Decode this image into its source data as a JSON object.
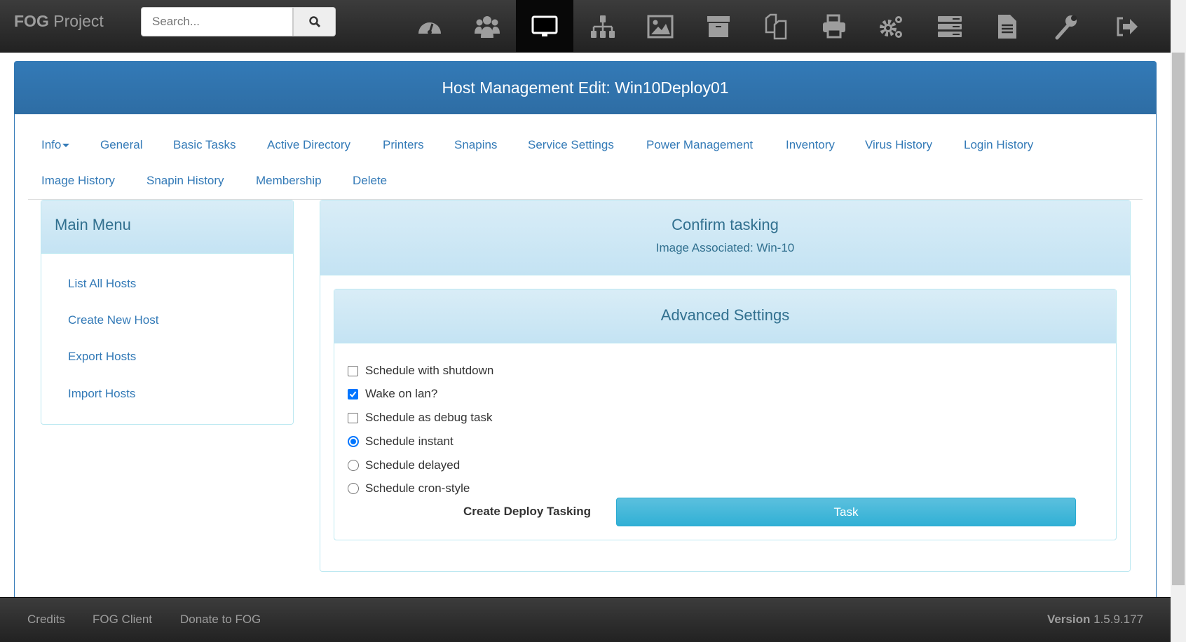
{
  "brand": {
    "bold": "FOG",
    "rest": "Project"
  },
  "search": {
    "placeholder": "Search..."
  },
  "nav_icons": [
    {
      "icon": "dashboard-icon",
      "active": false
    },
    {
      "icon": "users-icon",
      "active": false
    },
    {
      "icon": "monitor-icon",
      "active": true
    },
    {
      "icon": "sitemap-icon",
      "active": false
    },
    {
      "icon": "image-icon",
      "active": false
    },
    {
      "icon": "archive-icon",
      "active": false
    },
    {
      "icon": "copy-icon",
      "active": false
    },
    {
      "icon": "printer-icon",
      "active": false
    },
    {
      "icon": "cogs-icon",
      "active": false
    },
    {
      "icon": "server-icon",
      "active": false
    },
    {
      "icon": "file-icon",
      "active": false
    },
    {
      "icon": "wrench-icon",
      "active": false
    },
    {
      "icon": "logout-icon",
      "active": false
    }
  ],
  "header": {
    "title": "Host Management Edit: Win10Deploy01"
  },
  "tabs": {
    "row1": [
      "Info",
      "General",
      "Basic Tasks",
      "Active Directory",
      "Printers",
      "Snapins",
      "Service Settings",
      "Power Management",
      "Inventory",
      "Virus History",
      "Login History"
    ],
    "row2": [
      "Image History",
      "Snapin History",
      "Membership",
      "Delete"
    ]
  },
  "main_menu": {
    "title": "Main Menu",
    "items": [
      "List All Hosts",
      "Create New Host",
      "Export Hosts",
      "Import Hosts"
    ]
  },
  "confirm": {
    "title": "Confirm tasking",
    "subtitle": "Image Associated: Win-10"
  },
  "advanced": {
    "title": "Advanced Settings",
    "options": [
      {
        "type": "checkbox",
        "label": "Schedule with shutdown",
        "checked": false
      },
      {
        "type": "checkbox",
        "label": "Wake on lan?",
        "checked": true
      },
      {
        "type": "checkbox",
        "label": "Schedule as debug task",
        "checked": false
      },
      {
        "type": "radio",
        "label": "Schedule instant",
        "checked": true
      },
      {
        "type": "radio",
        "label": "Schedule delayed",
        "checked": false
      },
      {
        "type": "radio",
        "label": "Schedule cron-style",
        "checked": false
      }
    ],
    "action_label": "Create Deploy Tasking",
    "button": "Task"
  },
  "footer": {
    "links": [
      "Credits",
      "FOG Client",
      "Donate to FOG"
    ],
    "version_label": "Version",
    "version": "1.5.9.177"
  },
  "colors": {
    "link": "#337ab7",
    "header": "#337ab7",
    "panel_heading": "#31708f",
    "button": "#31b0d5"
  }
}
